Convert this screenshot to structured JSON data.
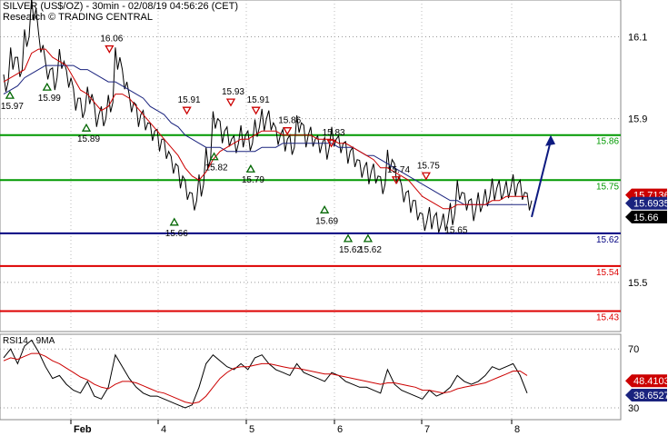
{
  "header": {
    "title": "SILVER (US$/OZ) - 30min - 02/08/19 04:56:26 (CET)",
    "source": "Research © TRADING CENTRAL"
  },
  "chart_data": [
    {
      "type": "line",
      "name": "price",
      "ylim": [
        15.38,
        16.19
      ],
      "y_ticks": [
        {
          "value": 16.1,
          "label": "16.1"
        },
        {
          "value": 15.9,
          "label": "15.9"
        },
        {
          "value": 15.5,
          "label": "15.5"
        }
      ],
      "x_ticks": [
        "Feb",
        "4",
        "5",
        "6",
        "7",
        "8"
      ],
      "price_series": {
        "close": [
          15.99,
          16.05,
          16.02,
          16.1,
          16.17,
          16.08,
          16.02,
          16.0,
          16.04,
          16.0,
          15.95,
          15.92,
          15.96,
          15.91,
          15.9,
          15.94,
          16.05,
          15.99,
          15.94,
          15.91,
          15.89,
          15.87,
          15.85,
          15.82,
          15.79,
          15.76,
          15.72,
          15.7,
          15.74,
          15.8,
          15.9,
          15.87,
          15.85,
          15.84,
          15.86,
          15.84,
          15.88,
          15.9,
          15.89,
          15.86,
          15.85,
          15.83,
          15.89,
          15.86,
          15.85,
          15.84,
          15.83,
          15.85,
          15.84,
          15.82,
          15.8,
          15.78,
          15.77,
          15.76,
          15.74,
          15.8,
          15.76,
          15.72,
          15.7,
          15.67,
          15.65,
          15.66,
          15.64,
          15.65,
          15.67,
          15.72,
          15.7,
          15.68,
          15.69,
          15.71,
          15.73,
          15.72,
          15.73,
          15.74,
          15.72,
          15.7
        ],
        "ema_red": [
          15.99,
          16.0,
          16.01,
          16.02,
          16.06,
          16.07,
          16.07,
          16.05,
          16.04,
          16.03,
          16.0,
          15.97,
          15.96,
          15.94,
          15.92,
          15.93,
          15.96,
          15.96,
          15.95,
          15.93,
          15.91,
          15.89,
          15.87,
          15.85,
          15.83,
          15.81,
          15.78,
          15.76,
          15.75,
          15.77,
          15.8,
          15.82,
          15.83,
          15.84,
          15.85,
          15.85,
          15.86,
          15.87,
          15.87,
          15.87,
          15.86,
          15.86,
          15.86,
          15.86,
          15.86,
          15.85,
          15.85,
          15.85,
          15.84,
          15.84,
          15.83,
          15.82,
          15.81,
          15.8,
          15.78,
          15.78,
          15.77,
          15.76,
          15.75,
          15.73,
          15.71,
          15.7,
          15.69,
          15.68,
          15.68,
          15.69,
          15.69,
          15.69,
          15.69,
          15.69,
          15.7,
          15.7,
          15.71,
          15.71,
          15.71,
          15.71
        ],
        "sma_blue": [
          15.96,
          15.97,
          15.98,
          16.0,
          16.01,
          16.02,
          16.03,
          16.03,
          16.03,
          16.03,
          16.03,
          16.02,
          16.02,
          16.01,
          16.0,
          15.99,
          15.99,
          15.98,
          15.97,
          15.96,
          15.95,
          15.93,
          15.92,
          15.91,
          15.89,
          15.88,
          15.86,
          15.85,
          15.84,
          15.83,
          15.83,
          15.83,
          15.82,
          15.82,
          15.82,
          15.82,
          15.82,
          15.83,
          15.83,
          15.83,
          15.84,
          15.84,
          15.84,
          15.84,
          15.84,
          15.84,
          15.84,
          15.84,
          15.83,
          15.83,
          15.83,
          15.82,
          15.81,
          15.81,
          15.8,
          15.79,
          15.78,
          15.77,
          15.76,
          15.75,
          15.74,
          15.73,
          15.72,
          15.71,
          15.7,
          15.7,
          15.69,
          15.69,
          15.69,
          15.69,
          15.69,
          15.69,
          15.69,
          15.69,
          15.69,
          15.69
        ]
      },
      "levels": [
        {
          "value": 15.86,
          "label": "15.86",
          "color": "#009900"
        },
        {
          "value": 15.75,
          "label": "15.75",
          "color": "#009900"
        },
        {
          "value": 15.62,
          "label": "15.62",
          "color": "#000080"
        },
        {
          "value": 15.54,
          "label": "15.54",
          "color": "#dd0000"
        },
        {
          "value": 15.43,
          "label": "15.43",
          "color": "#dd0000"
        }
      ],
      "current_tags": [
        {
          "value": 15.7136,
          "label": "15.7136",
          "bg": "#cc0000"
        },
        {
          "value": 15.6935,
          "label": "15.6935",
          "bg": "#1a237e"
        },
        {
          "value": 15.66,
          "label": "15.66",
          "bg": "#000000"
        }
      ],
      "swing_labels": [
        {
          "type": "low",
          "x": 0.012,
          "value": 15.97,
          "label": "15.97"
        },
        {
          "type": "low",
          "x": 0.083,
          "value": 15.99,
          "label": "15.99"
        },
        {
          "type": "low",
          "x": 0.158,
          "value": 15.89,
          "label": "15.89"
        },
        {
          "type": "high",
          "x": 0.202,
          "value": 16.06,
          "label": "16.06"
        },
        {
          "type": "low",
          "x": 0.326,
          "value": 15.66,
          "label": "15.66"
        },
        {
          "type": "high",
          "x": 0.35,
          "value": 15.91,
          "label": "15.91"
        },
        {
          "type": "low",
          "x": 0.402,
          "value": 15.82,
          "label": "15.82"
        },
        {
          "type": "high",
          "x": 0.434,
          "value": 15.93,
          "label": "15.93"
        },
        {
          "type": "low",
          "x": 0.472,
          "value": 15.79,
          "label": "15.79"
        },
        {
          "type": "high",
          "x": 0.482,
          "value": 15.91,
          "label": "15.91"
        },
        {
          "type": "high",
          "x": 0.542,
          "value": 15.86,
          "label": "15.86"
        },
        {
          "type": "low",
          "x": 0.613,
          "value": 15.69,
          "label": "15.69"
        },
        {
          "type": "high",
          "x": 0.626,
          "value": 15.83,
          "label": "15.83"
        },
        {
          "type": "low",
          "x": 0.658,
          "value": 15.62,
          "label": "15.62"
        },
        {
          "type": "low",
          "x": 0.696,
          "value": 15.62,
          "label": "15.62"
        },
        {
          "type": "high",
          "x": 0.75,
          "value": 15.74,
          "label": "15.74"
        },
        {
          "type": "high",
          "x": 0.807,
          "value": 15.75,
          "label": "15.75"
        },
        {
          "type": "label",
          "x": 0.86,
          "value": 15.65,
          "label": "15.65"
        }
      ],
      "forecast_arrow": {
        "from": 15.66,
        "to": 15.86
      },
      "colors": {
        "price": "#000000",
        "ema": "#cc0000",
        "sma": "#1a237e",
        "swing_high": "#cc0000",
        "swing_low": "#006600",
        "arrow": "#0d1a80"
      }
    },
    {
      "type": "line",
      "name": "RSI14 - 9MA",
      "title": "RSI14 - 9MA",
      "ylim": [
        22,
        80
      ],
      "y_ticks": [
        {
          "value": 70,
          "label": "70"
        },
        {
          "value": 30,
          "label": "30"
        }
      ],
      "rsi": [
        64,
        70,
        60,
        72,
        76,
        68,
        58,
        50,
        52,
        46,
        42,
        40,
        48,
        38,
        36,
        44,
        66,
        58,
        50,
        44,
        40,
        38,
        38,
        36,
        34,
        32,
        30,
        32,
        44,
        60,
        66,
        62,
        58,
        56,
        60,
        56,
        64,
        66,
        60,
        56,
        54,
        52,
        60,
        54,
        52,
        50,
        48,
        54,
        52,
        48,
        46,
        44,
        44,
        42,
        40,
        56,
        46,
        42,
        40,
        38,
        36,
        42,
        38,
        40,
        44,
        52,
        48,
        46,
        48,
        52,
        58,
        56,
        58,
        60,
        52,
        40
      ],
      "ma": [
        62,
        64,
        63,
        65,
        67,
        67,
        65,
        62,
        60,
        57,
        54,
        51,
        49,
        46,
        44,
        43,
        46,
        48,
        48,
        47,
        45,
        43,
        41,
        40,
        38,
        36,
        34,
        33,
        34,
        38,
        44,
        50,
        54,
        57,
        58,
        58,
        59,
        60,
        60,
        59,
        58,
        57,
        57,
        56,
        55,
        54,
        53,
        53,
        52,
        51,
        50,
        49,
        48,
        47,
        46,
        47,
        47,
        46,
        45,
        44,
        42,
        42,
        41,
        40,
        41,
        43,
        44,
        45,
        46,
        47,
        49,
        51,
        53,
        55,
        55,
        52
      ],
      "current_tags": [
        {
          "value": 48.4103,
          "label": "48.4103",
          "bg": "#cc0000"
        },
        {
          "value": 38.6527,
          "label": "38.6527",
          "bg": "#1a237e"
        }
      ],
      "colors": {
        "rsi": "#000000",
        "ma": "#cc0000"
      }
    }
  ]
}
